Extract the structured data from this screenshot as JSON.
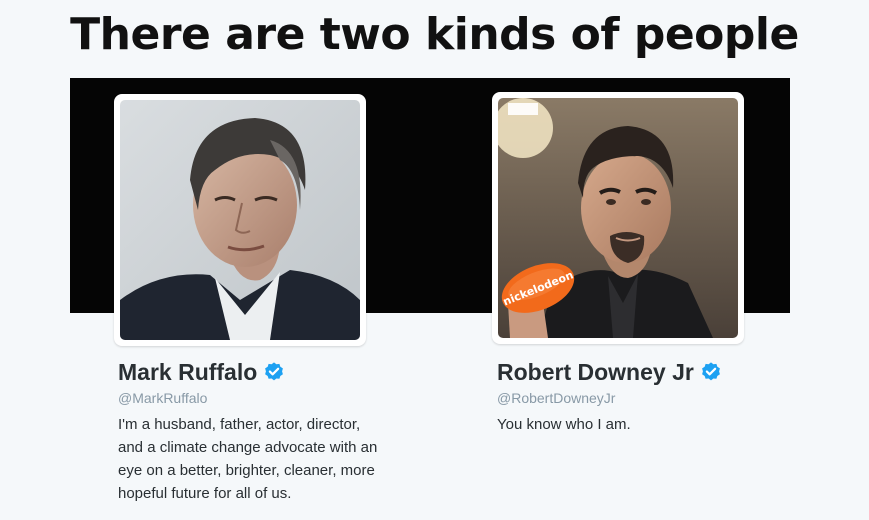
{
  "title": "There are two kinds of people",
  "colors": {
    "background": "#f5f8fa",
    "banner": "#050505",
    "name_text": "#292f33",
    "handle_text": "#8899a6",
    "verified_badge": "#1da1f2"
  },
  "profiles": [
    {
      "name": "Mark Ruffalo",
      "handle": "@MarkRuffalo",
      "verified": true,
      "verified_icon": "verified-badge-icon",
      "bio_lines": [
        "I'm a husband, father, actor, director,",
        "and a climate change advocate with an",
        "eye on a better, brighter, cleaner, more",
        "hopeful future for all of us."
      ]
    },
    {
      "name": "Robert Downey Jr",
      "handle": "@RobertDowneyJr",
      "verified": true,
      "verified_icon": "verified-badge-icon",
      "bio_lines": [
        "You know who I am."
      ],
      "photo_prop_text": "nickelodeon"
    }
  ]
}
